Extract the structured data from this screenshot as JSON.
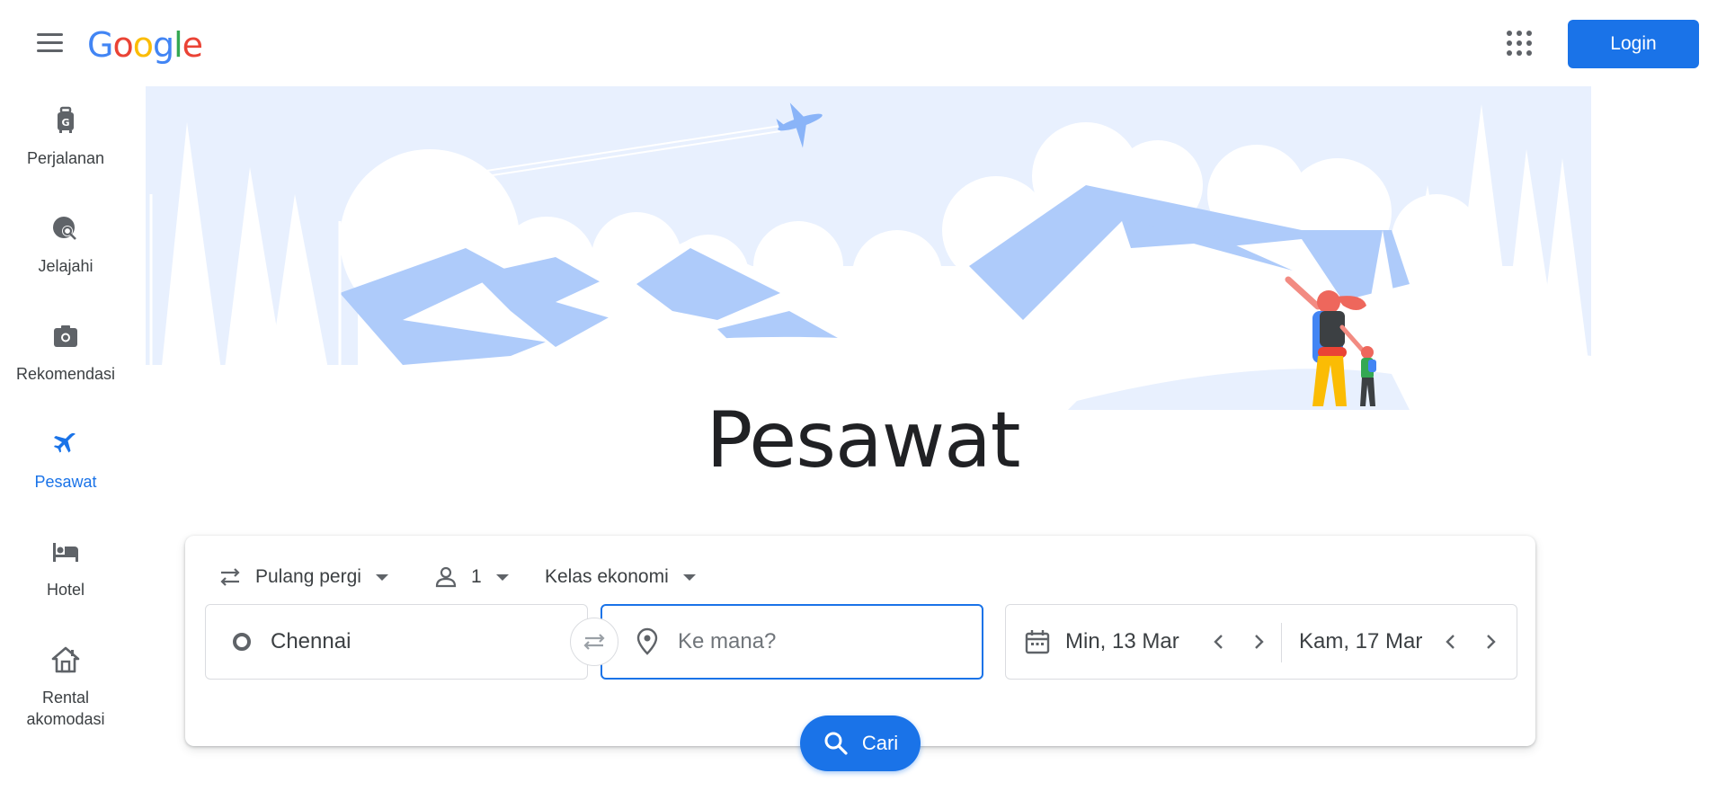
{
  "header": {
    "logo_text": "Google",
    "login_label": "Login",
    "icons": [
      "menu-icon",
      "apps-icon"
    ]
  },
  "sidenav": {
    "items": [
      {
        "label": "Perjalanan",
        "icon": "luggage-icon",
        "active": false
      },
      {
        "label": "Jelajahi",
        "icon": "travel-explore-icon",
        "active": false
      },
      {
        "label": "Rekomendasi",
        "icon": "camera-icon",
        "active": false
      },
      {
        "label": "Pesawat",
        "icon": "airplane-icon",
        "active": true
      },
      {
        "label": "Hotel",
        "icon": "bed-icon",
        "active": false
      },
      {
        "label": "Rental",
        "label2": "akomodasi",
        "icon": "house-icon",
        "active": false
      }
    ]
  },
  "page": {
    "title": "Pesawat"
  },
  "search": {
    "trip_type": "Pulang pergi",
    "passengers": "1",
    "cabin_class": "Kelas ekonomi",
    "origin": "Chennai",
    "destination_placeholder": "Ke mana?",
    "depart_date": "Min, 13 Mar",
    "return_date": "Kam, 17 Mar",
    "search_label": "Cari"
  },
  "colors": {
    "accent": "#1a73e8",
    "text": "#202124",
    "muted": "#5f6368",
    "hero_sky": "#e8f0fe",
    "hero_mountain": "#aecbfa"
  }
}
